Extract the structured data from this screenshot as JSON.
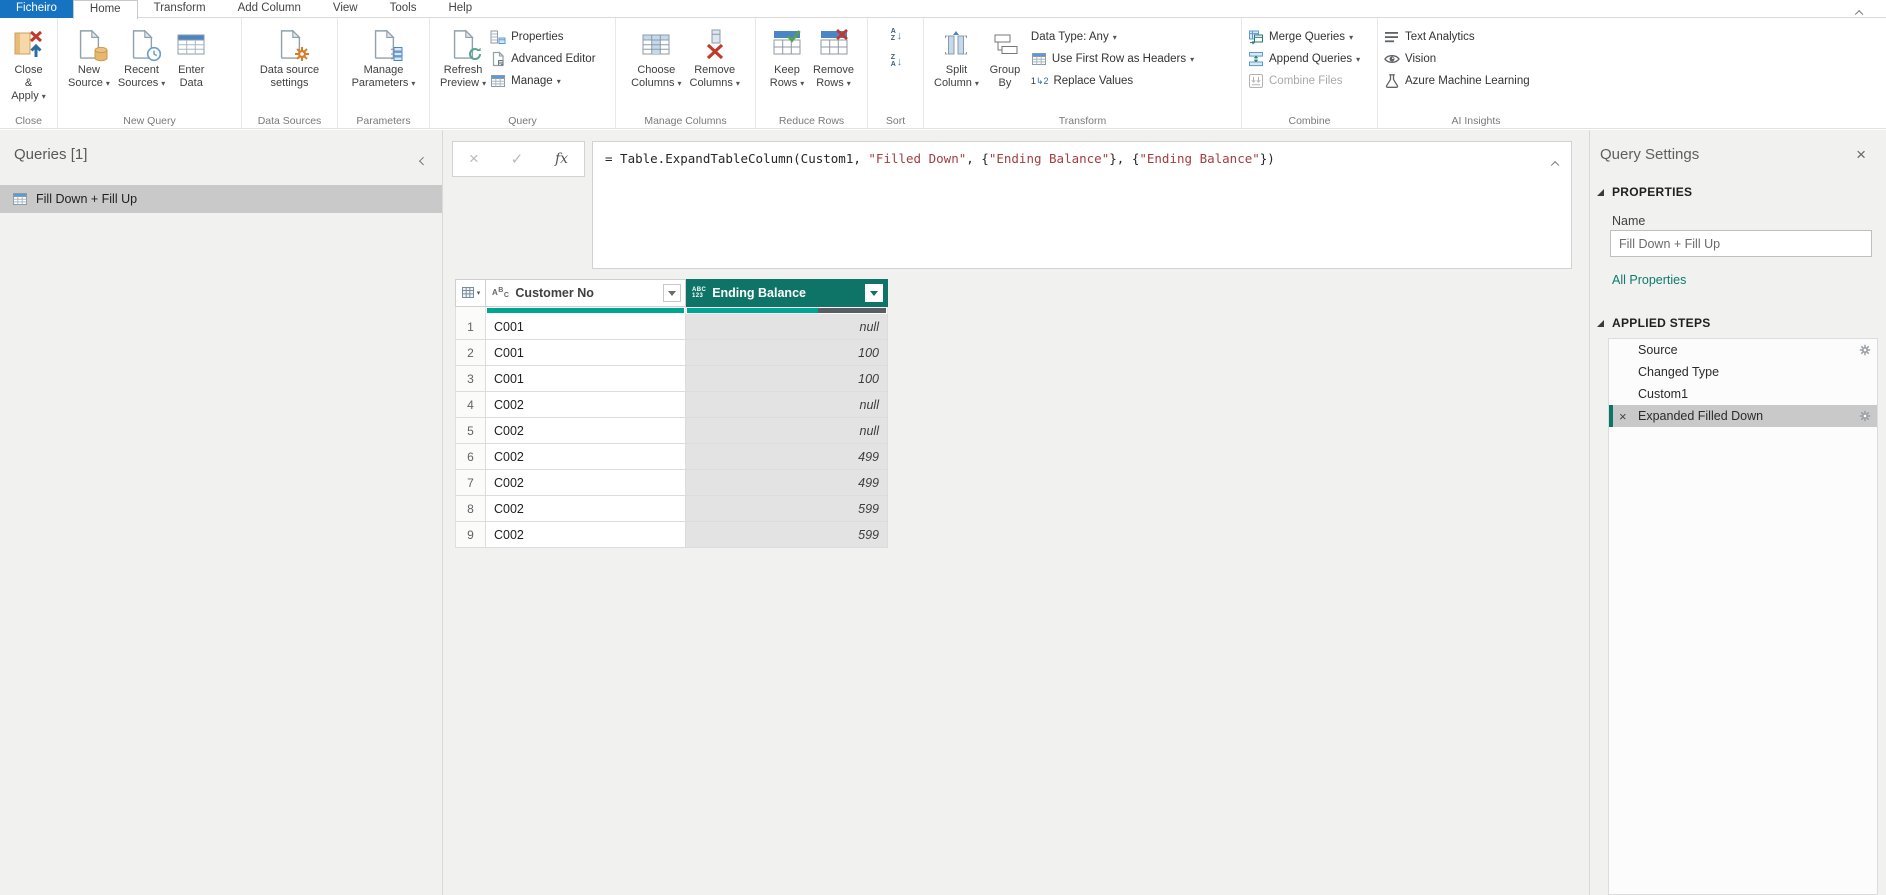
{
  "menubar": {
    "tabs": [
      {
        "label": "Ficheiro"
      },
      {
        "label": "Home"
      },
      {
        "label": "Transform"
      },
      {
        "label": "Add Column"
      },
      {
        "label": "View"
      },
      {
        "label": "Tools"
      },
      {
        "label": "Help"
      }
    ]
  },
  "ribbon": {
    "groups": {
      "close": {
        "label": "Close",
        "close_apply": "Close &\nApply"
      },
      "new_query": {
        "label": "New Query",
        "new_source": "New\nSource",
        "recent_sources": "Recent\nSources",
        "enter_data": "Enter\nData"
      },
      "data_sources": {
        "label": "Data Sources",
        "settings": "Data source\nsettings"
      },
      "parameters": {
        "label": "Parameters",
        "manage": "Manage\nParameters"
      },
      "query": {
        "label": "Query",
        "refresh": "Refresh\nPreview",
        "properties": "Properties",
        "advanced": "Advanced Editor",
        "manage": "Manage"
      },
      "manage_columns": {
        "label": "Manage Columns",
        "choose": "Choose\nColumns",
        "remove": "Remove\nColumns"
      },
      "reduce_rows": {
        "label": "Reduce Rows",
        "keep": "Keep\nRows",
        "remove": "Remove\nRows"
      },
      "sort": {
        "label": "Sort",
        "az": "A\nZ",
        "za": "Z\nA"
      },
      "transform": {
        "label": "Transform",
        "split": "Split\nColumn",
        "group_by": "Group\nBy",
        "data_type": "Data Type: Any",
        "first_row": "Use First Row as Headers",
        "replace": "Replace Values"
      },
      "combine": {
        "label": "Combine",
        "merge": "Merge Queries",
        "append": "Append Queries",
        "combine_files": "Combine Files"
      },
      "ai": {
        "label": "AI Insights",
        "text_analytics": "Text Analytics",
        "vision": "Vision",
        "aml": "Azure Machine Learning"
      }
    }
  },
  "formula_bar": {
    "cancel": "×",
    "check": "✓",
    "fx": "fx",
    "segments": [
      {
        "type": "code",
        "text": "= Table.ExpandTableColumn(Custom1, "
      },
      {
        "type": "string",
        "text": "\"Filled Down\""
      },
      {
        "type": "code",
        "text": ", {"
      },
      {
        "type": "string",
        "text": "\"Ending Balance\""
      },
      {
        "type": "code",
        "text": "}, {"
      },
      {
        "type": "string",
        "text": "\"Ending Balance\""
      },
      {
        "type": "code",
        "text": "})"
      }
    ]
  },
  "queries_panel": {
    "title": "Queries [1]",
    "items": [
      {
        "label": "Fill Down + Fill Up",
        "selected": true,
        "icon": "table-icon"
      }
    ]
  },
  "table": {
    "columns": [
      {
        "type_label": "ABC",
        "name": "Customer No",
        "quality_filled_pct": 100,
        "selected": false
      },
      {
        "type_label_top": "ABC",
        "type_label_bottom": "123",
        "name": "Ending Balance",
        "quality_filled_pct": 66,
        "selected": true
      }
    ],
    "rows": [
      {
        "n": "1",
        "customer": "C001",
        "balance": "null"
      },
      {
        "n": "2",
        "customer": "C001",
        "balance": "100"
      },
      {
        "n": "3",
        "customer": "C001",
        "balance": "100"
      },
      {
        "n": "4",
        "customer": "C002",
        "balance": "null"
      },
      {
        "n": "5",
        "customer": "C002",
        "balance": "null"
      },
      {
        "n": "6",
        "customer": "C002",
        "balance": "499"
      },
      {
        "n": "7",
        "customer": "C002",
        "balance": "499"
      },
      {
        "n": "8",
        "customer": "C002",
        "balance": "599"
      },
      {
        "n": "9",
        "customer": "C002",
        "balance": "599"
      }
    ]
  },
  "query_settings": {
    "title": "Query Settings",
    "properties_label": "PROPERTIES",
    "name_label": "Name",
    "name_value": "Fill Down + Fill Up",
    "all_properties_label": "All Properties",
    "applied_steps_label": "APPLIED STEPS",
    "steps": [
      {
        "label": "Source",
        "gear": true
      },
      {
        "label": "Changed Type"
      },
      {
        "label": "Custom1"
      },
      {
        "label": "Expanded Filled Down",
        "selected": true,
        "gear": true,
        "remove_icon": "close-icon"
      }
    ]
  },
  "colors": {
    "accent_teal": "#0e7467",
    "quality_teal": "#00a591",
    "quality_dark": "#585e62",
    "file_tab_blue": "#1673c1",
    "link_teal": "#0c7b6b",
    "string_red": "#a33e3e",
    "selected_gray": "#c9c9c9",
    "selected_column_bg": "#e3e3e3"
  }
}
